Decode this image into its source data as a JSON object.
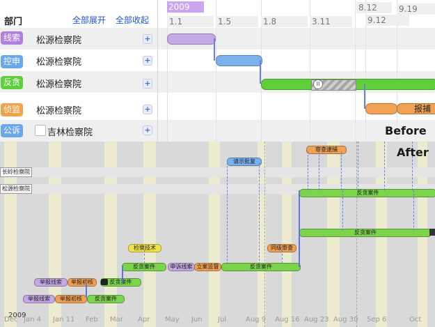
{
  "before_panel": {
    "header": {
      "dept": "部门",
      "expand_all": "全部展开",
      "collapse_all": "全部收起"
    },
    "rows": [
      {
        "tag": "线索",
        "tag_color": "#b07fe0",
        "org": "松源检察院"
      },
      {
        "tag": "控申",
        "tag_color": "#6aa7ec",
        "org": "松源检察院"
      },
      {
        "tag": "反贪",
        "tag_color": "#5fcf3a",
        "org": "松源检察院"
      },
      {
        "tag": "侦监",
        "tag_color": "#f2a24a",
        "org": "松源检察院"
      },
      {
        "tag": "公诉",
        "tag_color": "#6aa7ec",
        "org": "吉林检察院"
      }
    ],
    "timeline": {
      "year": "2009",
      "dates_row1": [
        "1.1",
        "1.5",
        "1.8",
        "3.11",
        "9.12"
      ],
      "dates_top": [
        "8.12",
        "9.19"
      ],
      "bar_label": "报捕"
    },
    "label": "Before"
  },
  "after_panel": {
    "label": "After",
    "row_labels": [
      "长岭检察院",
      "松源检察院"
    ],
    "bars": {
      "shencha_daibu": "审查逮捕",
      "qingshi_pizhun": "请示批复",
      "fantan_anjian_a": "反贪案件",
      "fantan_anjian_b": "反贪案件",
      "jiancha_jishu": "检察技术",
      "shangji_shencha": "同级审查",
      "fantan_anjian_c": "反贪案件",
      "shensu_xiansuo": "申诉线索",
      "lian_jiandu": "立案监督",
      "fantan_anjian_d": "反贪案件",
      "jubao_xiansuo_1": "举报线索",
      "jubao_chuhe_1": "举报初核",
      "fantan_anjian_e": "反贪案件",
      "jubao_xiansuo_2": "举报线索",
      "jubao_chuhe_2": "举报初核",
      "fantan_anjian_f": "反贪案件"
    },
    "year": "2009",
    "months": [
      "Dec",
      "Jan 4",
      "Jan 11",
      "Feb",
      "Mar",
      "Apr",
      "May",
      "Jun",
      "Jul",
      "Aug 9",
      "Aug 16",
      "Aug 23",
      "Aug 30",
      "Sep 6",
      "Oct"
    ]
  },
  "colors": {
    "green": "#7bd44c",
    "purple": "#c5a9e7",
    "orange": "#f0a153",
    "blue": "#7bb2ee",
    "yellow": "#f2e14a",
    "link": "#1c55d6",
    "connector": "#5e74e6"
  }
}
